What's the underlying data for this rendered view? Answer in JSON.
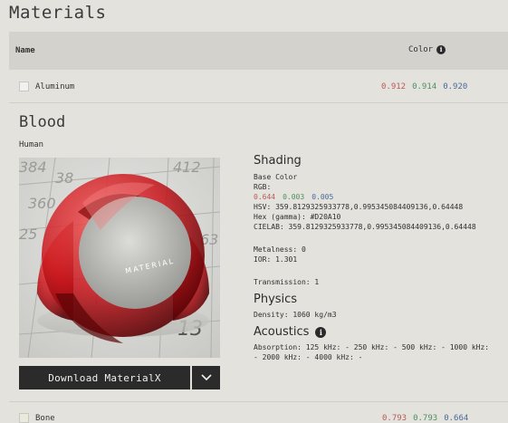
{
  "page": {
    "title": "Materials"
  },
  "table": {
    "col_name": "Name",
    "col_color": "Color"
  },
  "rows": [
    {
      "name": "Aluminum",
      "r": "0.912",
      "g": "0.914",
      "b": "0.920",
      "swatch": "#f1f1f2"
    },
    {
      "name": "Bone",
      "r": "0.793",
      "g": "0.793",
      "b": "0.664",
      "swatch": "#ebe9db"
    }
  ],
  "detail": {
    "title": "Blood",
    "subtitle": "Human",
    "download_label": "Download MaterialX",
    "preview_label": "MATERIAL",
    "preview_numbers": [
      "384",
      "38",
      "412",
      "360",
      "25",
      "63",
      "13"
    ],
    "shading": {
      "heading": "Shading",
      "base_color_label": "Base Color",
      "rgb_label": "RGB:",
      "r": "0.644",
      "g": "0.003",
      "b": "0.005",
      "hsv": "HSV: 359.8129325933778,0.995345084409136,0.64448",
      "hex": "Hex (gamma): #D20A10",
      "cielab": "CIELAB: 359.8129325933778,0.995345084409136,0.64448",
      "metalness": "Metalness: 0",
      "ior": "IOR: 1.301",
      "transmission": "Transmission: 1"
    },
    "physics": {
      "heading": "Physics",
      "density": "Density: 1060 kg/m3"
    },
    "acoustics": {
      "heading": "Acoustics",
      "absorption_line1": "Absorption: 125 kHz: - 250 kHz: - 500 kHz: - 1000 kHz:",
      "absorption_line2": "- 2000 kHz: - 4000 kHz: -"
    }
  },
  "colors": {
    "accent_red": "#b85a5a",
    "accent_green": "#4e8f5e",
    "accent_blue": "#4a6a9a",
    "button_dark": "#2b2b2b"
  },
  "icons": {
    "info": "info-icon",
    "dropdown": "chevron-down-icon"
  }
}
